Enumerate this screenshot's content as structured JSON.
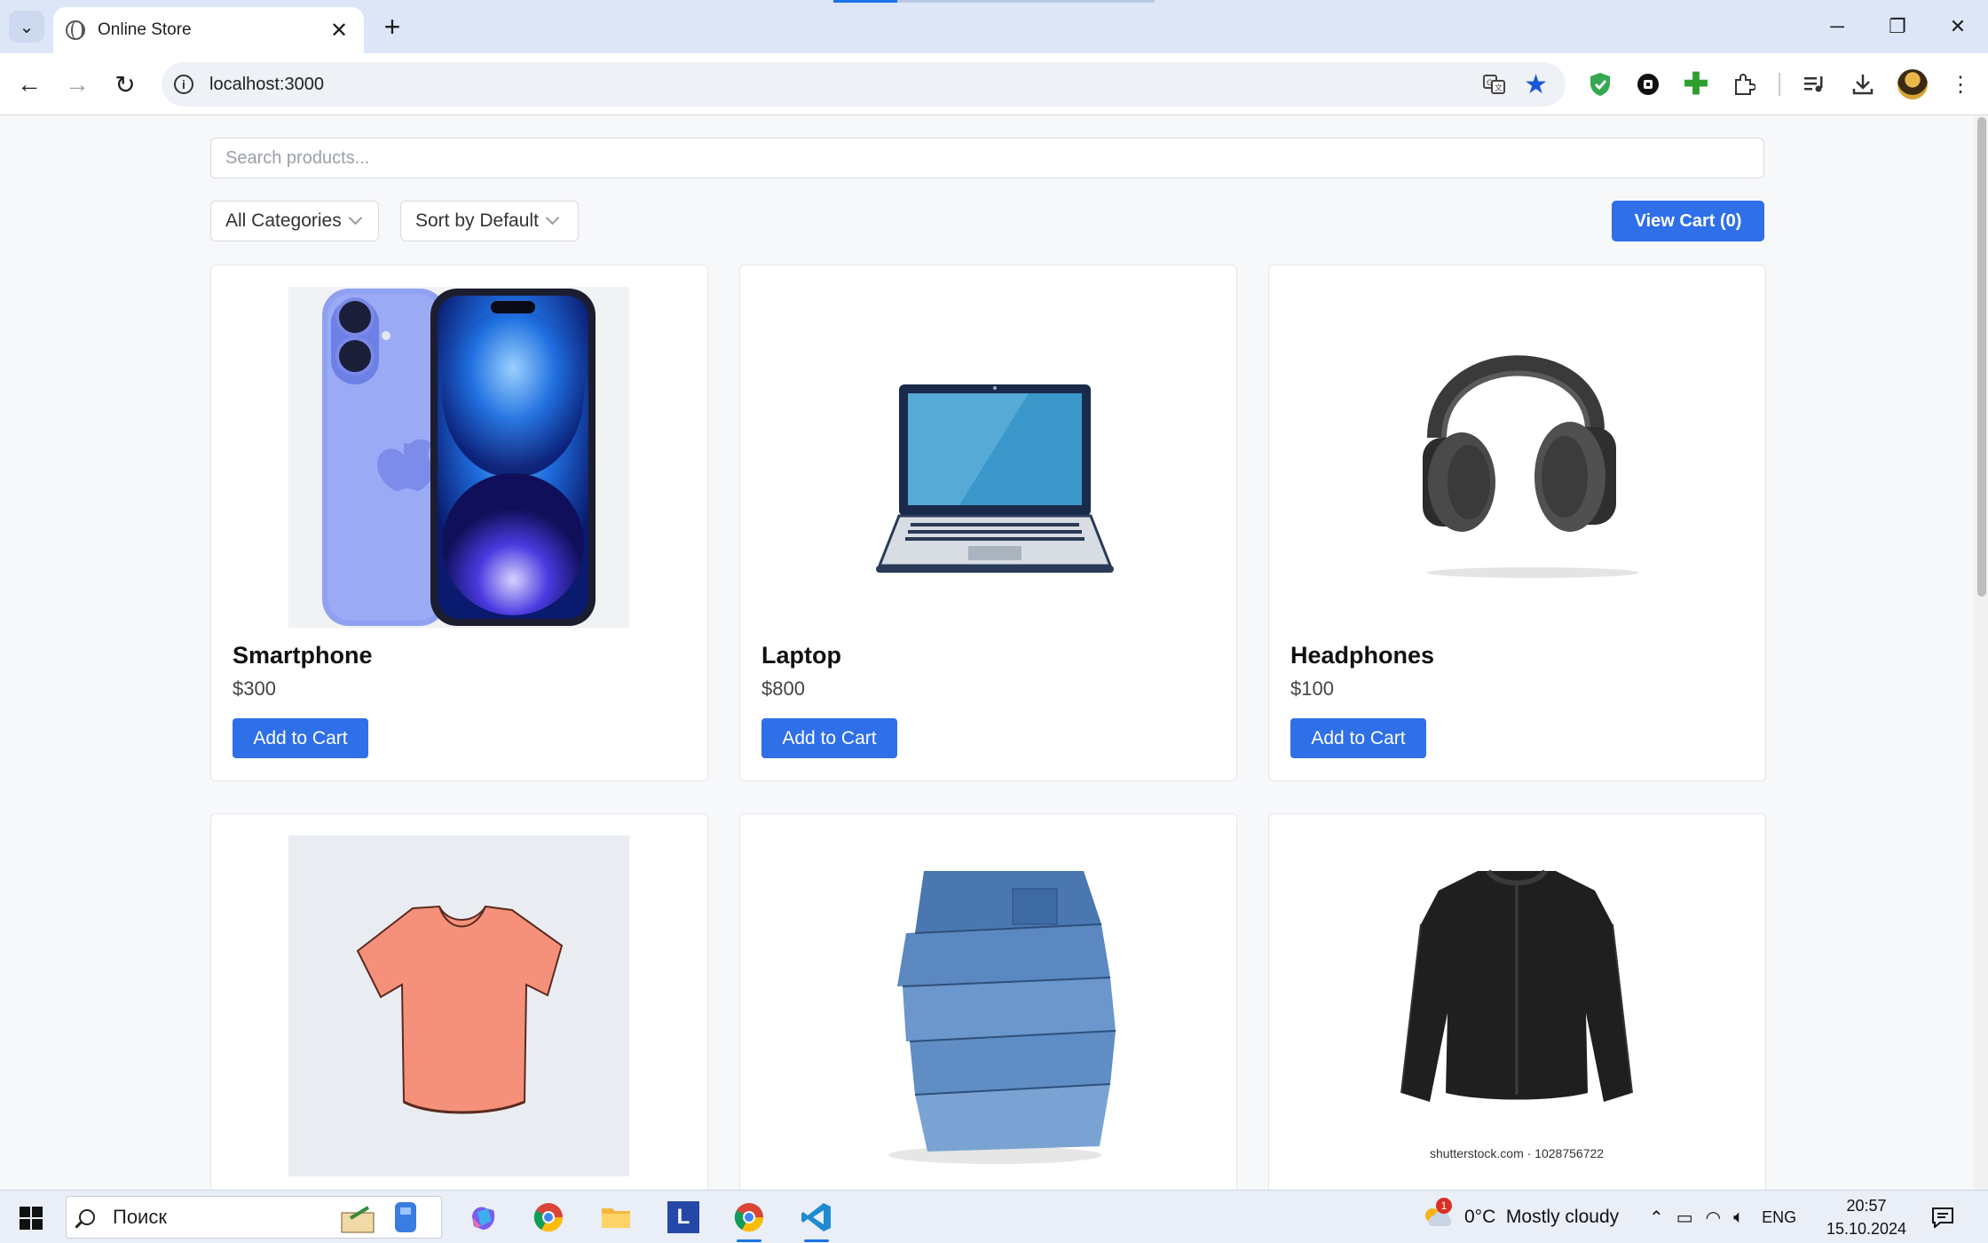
{
  "browser": {
    "tab_title": "Online Store",
    "url": "localhost:3000"
  },
  "page": {
    "search_placeholder": "Search products...",
    "category_filter": "All Categories",
    "sort_filter": "Sort by Default",
    "view_cart_label": "View Cart (0)"
  },
  "products": [
    {
      "name": "Smartphone",
      "price": "$300",
      "button": "Add to Cart",
      "image": "smartphone-image"
    },
    {
      "name": "Laptop",
      "price": "$800",
      "button": "Add to Cart",
      "image": "laptop-image"
    },
    {
      "name": "Headphones",
      "price": "$100",
      "button": "Add to Cart",
      "image": "headphones-image"
    },
    {
      "name": "",
      "price": "",
      "button": "",
      "image": "tshirt-image"
    },
    {
      "name": "",
      "price": "",
      "button": "",
      "image": "jeans-image"
    },
    {
      "name": "",
      "price": "",
      "button": "",
      "image": "jacket-image",
      "watermark": "shutterstock.com · 1028756722"
    }
  ],
  "taskbar": {
    "search_label": "Поиск",
    "weather": "0°C  Mostly cloudy",
    "weather_badge": "1",
    "language": "ENG",
    "time": "20:57",
    "date": "15.10.2024"
  },
  "colors": {
    "accent": "#2f6fe8",
    "browser_frame": "#dce6f7"
  }
}
